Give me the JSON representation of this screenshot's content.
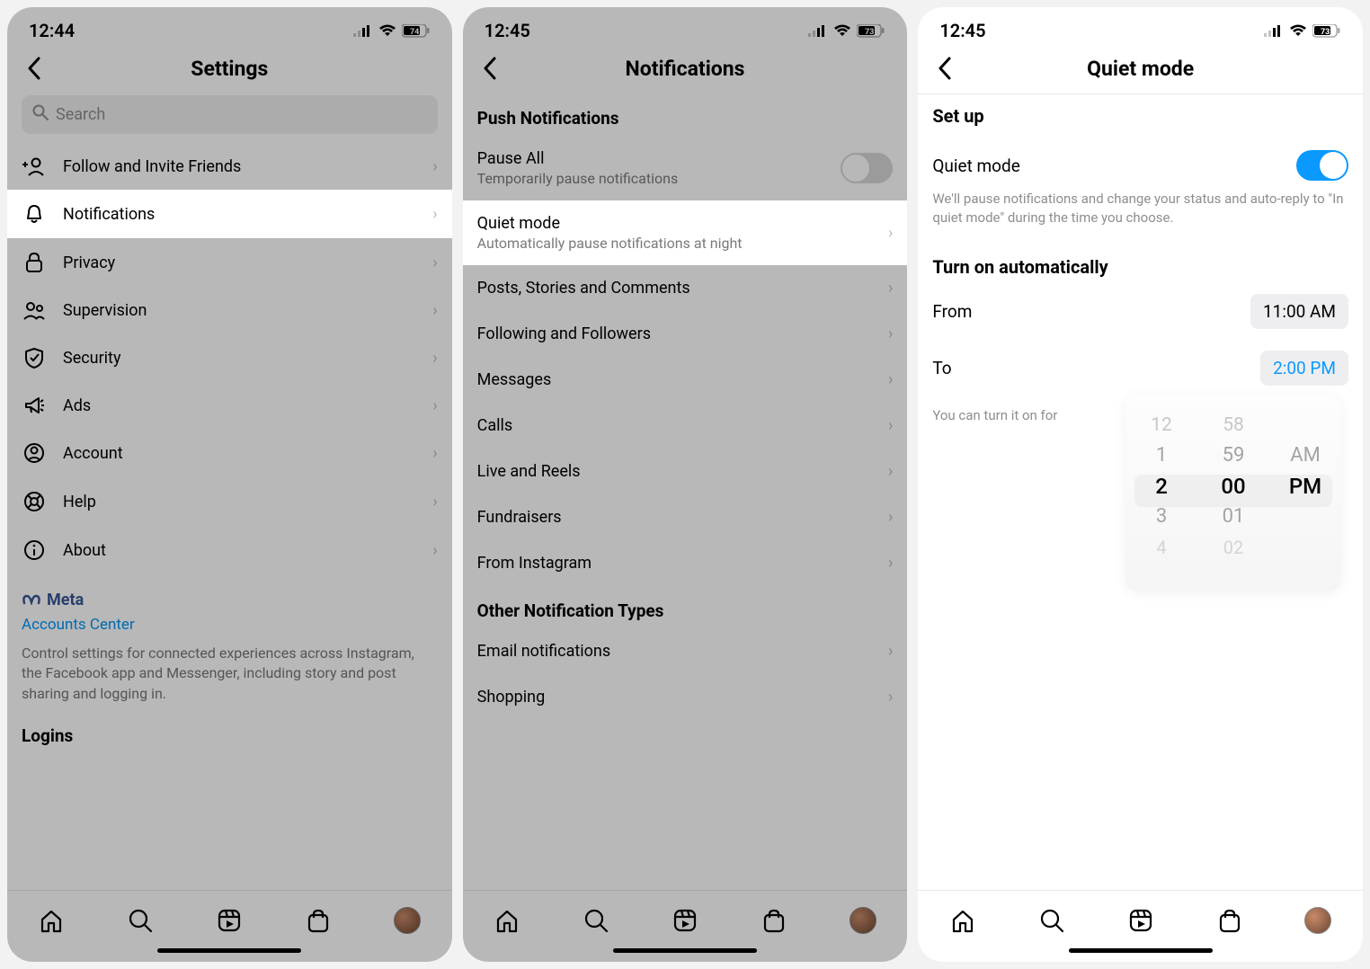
{
  "screen1": {
    "time": "12:44",
    "battery": "74",
    "title": "Settings",
    "search_placeholder": "Search",
    "items": {
      "follow": "Follow and Invite Friends",
      "notifications": "Notifications",
      "privacy": "Privacy",
      "supervision": "Supervision",
      "security": "Security",
      "ads": "Ads",
      "account": "Account",
      "help": "Help",
      "about": "About"
    },
    "meta_label": "Meta",
    "accounts_center": "Accounts Center",
    "meta_desc": "Control settings for connected experiences across Instagram, the Facebook app and Messenger, including story and post sharing and logging in.",
    "logins": "Logins"
  },
  "screen2": {
    "time": "12:45",
    "battery": "73",
    "title": "Notifications",
    "section_push": "Push Notifications",
    "pause_title": "Pause All",
    "pause_desc": "Temporarily pause notifications",
    "quiet_title": "Quiet mode",
    "quiet_desc": "Automatically pause notifications at night",
    "items": {
      "posts": "Posts, Stories and Comments",
      "following": "Following and Followers",
      "messages": "Messages",
      "calls": "Calls",
      "live": "Live and Reels",
      "fundraisers": "Fundraisers",
      "from_ig": "From Instagram"
    },
    "section_other": "Other Notification Types",
    "other": {
      "email": "Email notifications",
      "shopping": "Shopping"
    }
  },
  "screen3": {
    "time": "12:45",
    "battery": "73",
    "title": "Quiet mode",
    "setup_header": "Set up",
    "quiet_mode_label": "Quiet mode",
    "quiet_mode_desc": "We'll pause notifications and change your status and auto-reply to \"In quiet mode\" during the time you choose.",
    "auto_header": "Turn on automatically",
    "from_label": "From",
    "from_value": "11:00 AM",
    "to_label": "To",
    "to_value": "2:00 PM",
    "hint": "You can turn it on for",
    "picker": {
      "hours": [
        "12",
        "1",
        "2",
        "3",
        "4"
      ],
      "minutes": [
        "58",
        "59",
        "00",
        "01",
        "02"
      ],
      "ampm": [
        "",
        "AM",
        "PM",
        "",
        ""
      ]
    }
  }
}
